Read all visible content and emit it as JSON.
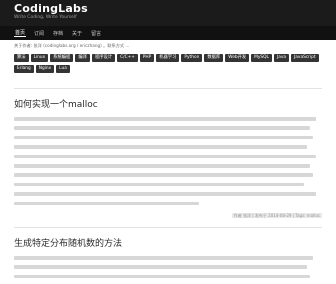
{
  "header": {
    "title": "CodingLabs",
    "tagline": "Write Coding, Write Yourself"
  },
  "nav": {
    "items": [
      {
        "label": "首页",
        "active": true
      },
      {
        "label": "订阅",
        "active": false
      },
      {
        "label": "存档",
        "active": false
      },
      {
        "label": "关于",
        "active": false
      },
      {
        "label": "留言",
        "active": false
      }
    ]
  },
  "intro": "关于作者: 张洋 (codinglabs.org / ericzhang) 。联系方式 ...",
  "tags": [
    "算法",
    "Linux",
    "系统编程",
    "编译",
    "程序设计",
    "C/C++",
    "PHP",
    "机器学习",
    "Python",
    "数据库",
    "Web开发",
    "MySQL",
    "Java",
    "JavaScript",
    "Erlang",
    "Nginx",
    "Lua"
  ],
  "articles": [
    {
      "title": "如何实现一个malloc",
      "meta": "作者 张洋 | 发布于 2014-08-29 | Tags: malloc"
    },
    {
      "title": "生成特定分布随机数的方法"
    }
  ],
  "colors": {
    "header_bg": "#1b1b1b",
    "nav_bg": "#111111",
    "tag_bg": "#343434"
  }
}
